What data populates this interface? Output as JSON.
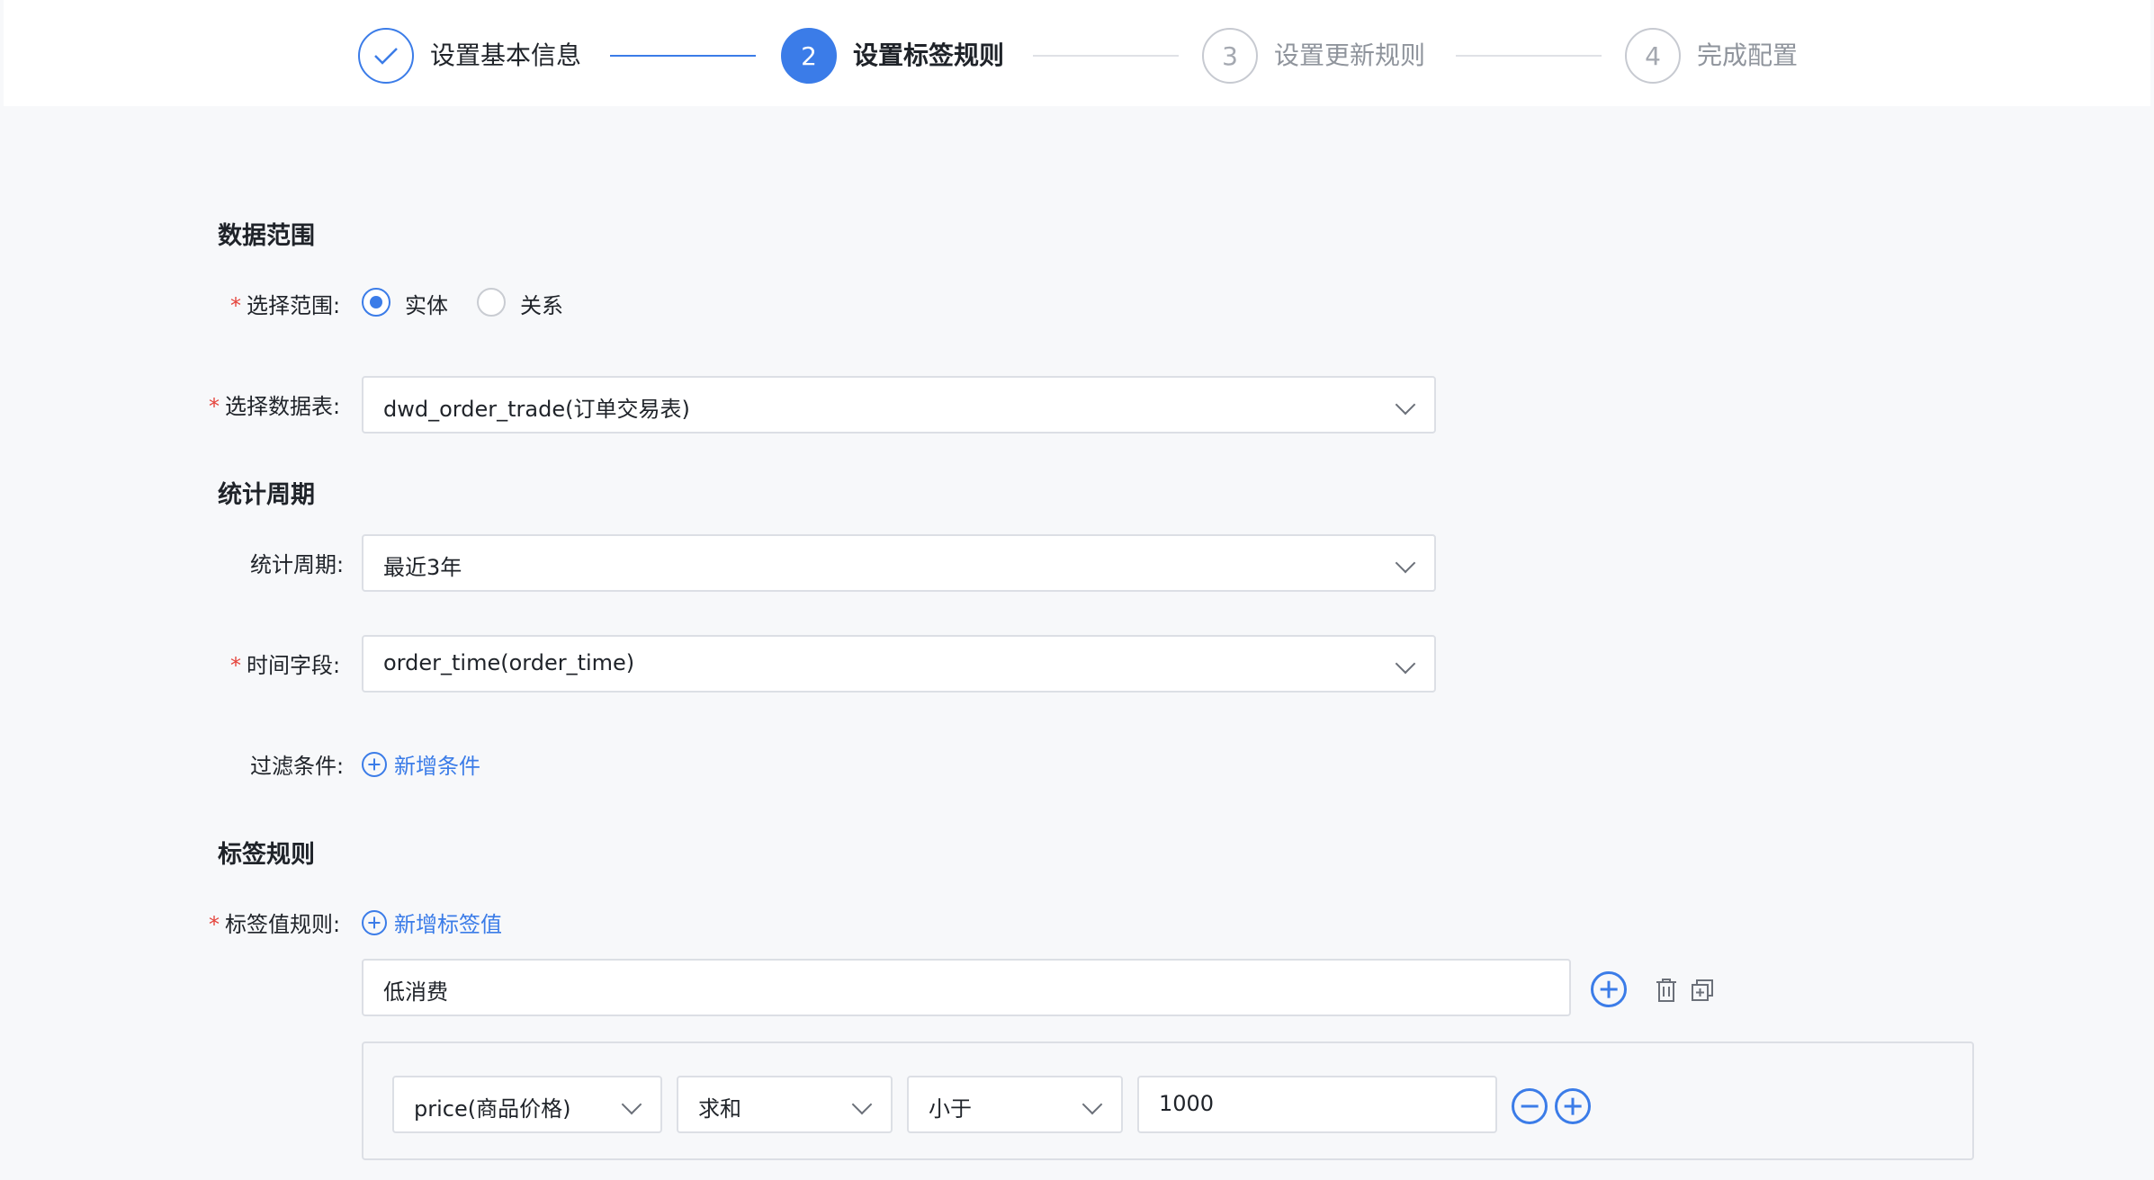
{
  "steps": [
    {
      "number": "✓",
      "label": "设置基本信息",
      "state": "done"
    },
    {
      "number": "2",
      "label": "设置标签规则",
      "state": "active"
    },
    {
      "number": "3",
      "label": "设置更新规则",
      "state": "wait"
    },
    {
      "number": "4",
      "label": "完成配置",
      "state": "wait"
    }
  ],
  "data_scope": {
    "title": "数据范围",
    "range_label": "选择范围:",
    "range_options": [
      "实体",
      "关系"
    ],
    "range_selected": "实体",
    "table_label": "选择数据表:",
    "table_value": "dwd_order_trade(订单交易表)"
  },
  "period": {
    "title": "统计周期",
    "period_label": "统计周期:",
    "period_value": "最近3年",
    "time_field_label": "时间字段:",
    "time_field_value": "order_time(order_time)",
    "filter_label": "过滤条件:",
    "filter_add": "新增条件"
  },
  "tag_rules": {
    "title": "标签规则",
    "rule_label": "标签值规则:",
    "add_tag_value": "新增标签值",
    "tag_value": "低消费",
    "condition": {
      "field": "price(商品价格)",
      "aggregate": "求和",
      "operator": "小于",
      "value": "1000"
    }
  },
  "colors": {
    "primary": "#3b7ce8",
    "required": "#e5443c"
  }
}
